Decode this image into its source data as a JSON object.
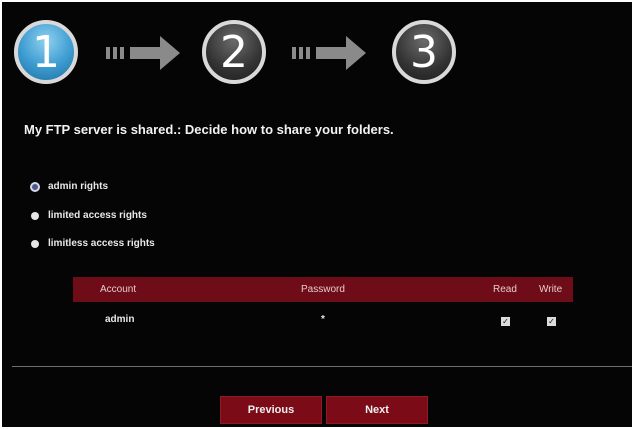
{
  "steps": [
    "1",
    "2",
    "3"
  ],
  "heading": "My FTP server is shared.: Decide how to share your folders.",
  "options": [
    {
      "label": "admin rights",
      "selected": true
    },
    {
      "label": "limited access rights",
      "selected": false
    },
    {
      "label": "limitless access rights",
      "selected": false
    }
  ],
  "table": {
    "headers": {
      "account": "Account",
      "password": "Password",
      "read": "Read",
      "write": "Write"
    },
    "rows": [
      {
        "account": "admin",
        "password": "*",
        "read": true,
        "write": true
      }
    ]
  },
  "buttons": {
    "previous": "Previous",
    "next": "Next"
  },
  "colors": {
    "background": "#050505",
    "accent": "#7a0b17",
    "active_step": "#3c9bd0"
  }
}
